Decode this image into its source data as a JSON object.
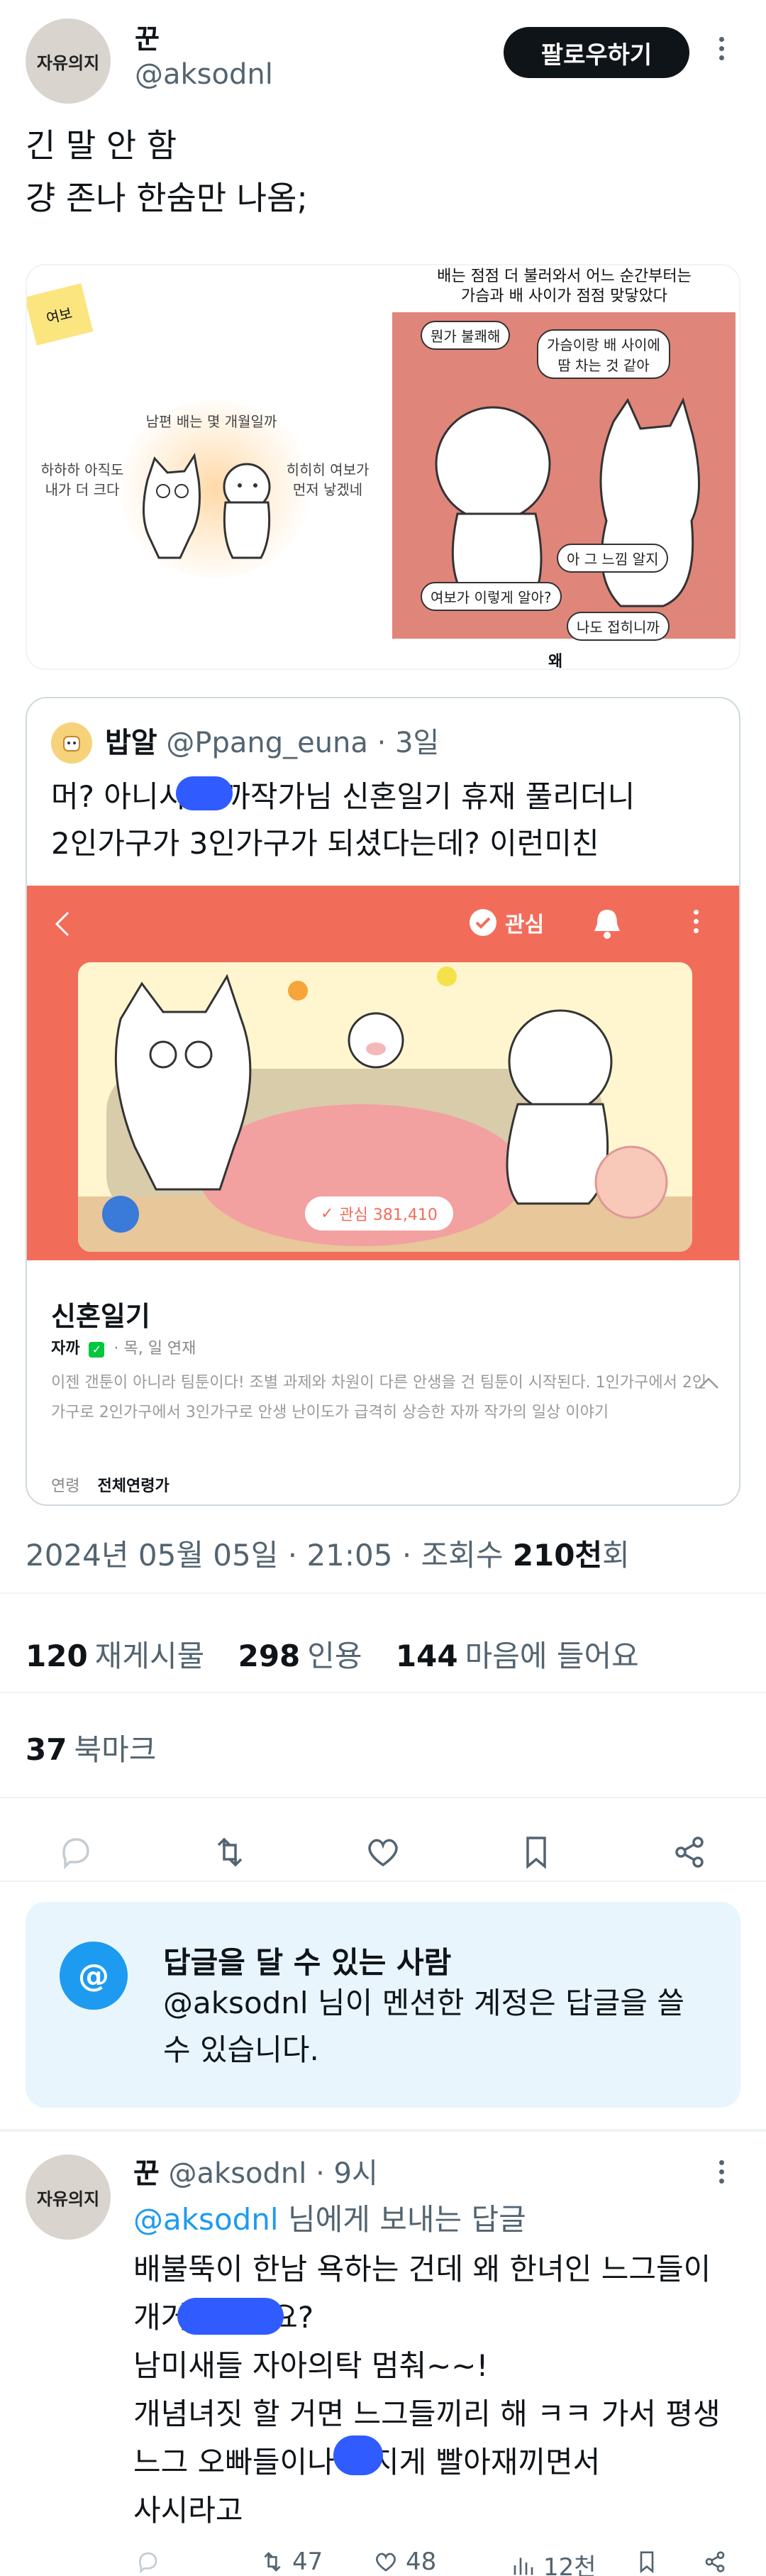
{
  "post": {
    "author_name": "꾼",
    "author_handle": "@aksodnl",
    "avatar_text": "자유의지",
    "follow_label": "팔로우하기",
    "text_line1": "긴 말 안 함",
    "text_line2": "걍 존나 한숨만 나옴;"
  },
  "comic": {
    "sticky_note": "여보",
    "left_caption": "남편 배는 몇 개월일까",
    "left_speech_a": "하하하 아직도\n내가 더 크다",
    "left_speech_b": "히히히 여보가\n먼저 낳겠네",
    "right_caption": "배는 점점 더 불러와서 어느 순간부터는\n가슴과 배 사이가 점점 맞닿았다",
    "bubble_1": "뭔가 불쾌해",
    "bubble_2": "가슴이랑 배 사이에\n땀 차는 것 같아",
    "bubble_3": "아 그 느낌 알지",
    "bubble_4": "여보가 이렇게 알아?",
    "bubble_5": "나도 접히니까",
    "bottom_text": "왜"
  },
  "quote": {
    "author_name": "밥알",
    "author_handle": "@Ppang_euna",
    "time": "· 3일",
    "text_line1": "머? 아니시 자까작가님 신혼일기 휴재 풀리더니",
    "text_line2": "2인가구가 3인가구가 되셨다는데? 이런미친",
    "follow_label": "관심",
    "interest_badge": "관심 381,410",
    "webtoon_title": "신혼일기",
    "webtoon_author": "자까",
    "webtoon_schedule": "· 목, 일 연재",
    "webtoon_desc": "이젠 갠툰이 아니라 팀툰이다! 조별 과제와 차원이 다른 안생을 건 팀툰이 시작된다. 1인가구에서 2인가구로 2인가구에서 3인가구로 안생 난이도가 급격히 상승한 자까 작가의 일상 이야기",
    "age_label": "연령",
    "age_value": "전체연령가"
  },
  "meta": {
    "date": "2024년 05월 05일 · 21:05 · 조회수 ",
    "views": "210천",
    "views_suffix": "회"
  },
  "stats": {
    "retweets": "120",
    "retweets_label": "재게시물",
    "quotes": "298",
    "quotes_label": "인용",
    "likes": "144",
    "likes_label": "마음에 들어요",
    "bookmarks": "37",
    "bookmarks_label": "북마크"
  },
  "reply_info": {
    "title": "답글을 달 수 있는 사람",
    "body": "@aksodnl 님이 멘션한 계정은 답글을 쓸 수 있습니다."
  },
  "reply": {
    "author_name": "꾼",
    "author_handle": "@aksodnl",
    "time": "· 9시",
    "avatar_text": "자유의지",
    "reply_to_mention": "@aksodnl",
    "reply_to_suffix": " 님에게 보내는 답글",
    "line1": "배불뚝이 한남 욕하는 건데 왜 한녀인 느그들이",
    "line2": "개거품이세요?",
    "line3": "남미새들 자아의탁 멈춰~~!",
    "line4": "개념녀짓 할 거면 느그들끼리 해 ㅋㅋ 가서 평생",
    "line5": "느그 오빠들이나 빠지게 빨아재끼면서",
    "line6": "사시라고",
    "retweets": "47",
    "likes": "48",
    "views": "12천"
  },
  "colors": {
    "accent": "#1d9bf0",
    "webtoon_bar": "#f26c5a"
  }
}
